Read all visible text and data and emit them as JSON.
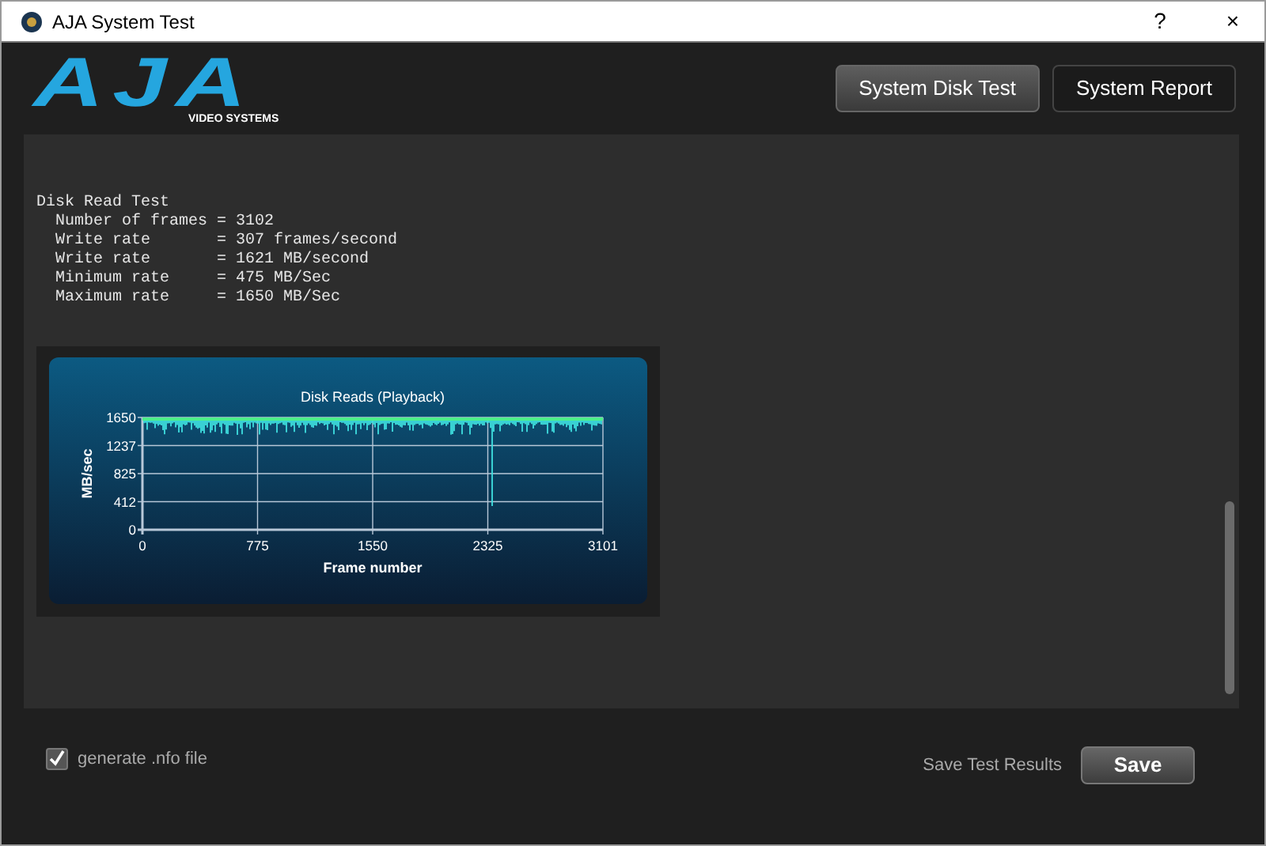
{
  "window": {
    "title": "AJA System Test",
    "help": "?",
    "close": "×"
  },
  "logo": {
    "name": "AJA",
    "tagline": "VIDEO SYSTEMS"
  },
  "header_buttons": [
    {
      "label": "System Disk Test",
      "selected": true
    },
    {
      "label": "System Report",
      "selected": false
    }
  ],
  "log": [
    "Disk Read Test",
    "  Number of frames = 3102",
    "  Write rate       = 307 frames/second",
    "  Write rate       = 1621 MB/second",
    "  Minimum rate     = 475 MB/Sec",
    "  Maximum rate     = 1650 MB/Sec"
  ],
  "chart": {
    "title": "Disk Reads (Playback)",
    "xlabel": "Frame number",
    "ylabel": "MB/sec",
    "xticks": [
      "0",
      "775",
      "1550",
      "2325",
      "3101"
    ],
    "yticks": [
      "1650",
      "1237",
      "825",
      "412",
      "0"
    ]
  },
  "footer": {
    "checkbox": {
      "label": "generate .nfo file",
      "checked": true
    },
    "save_label": "Save Test Results",
    "save_button": "Save"
  }
}
